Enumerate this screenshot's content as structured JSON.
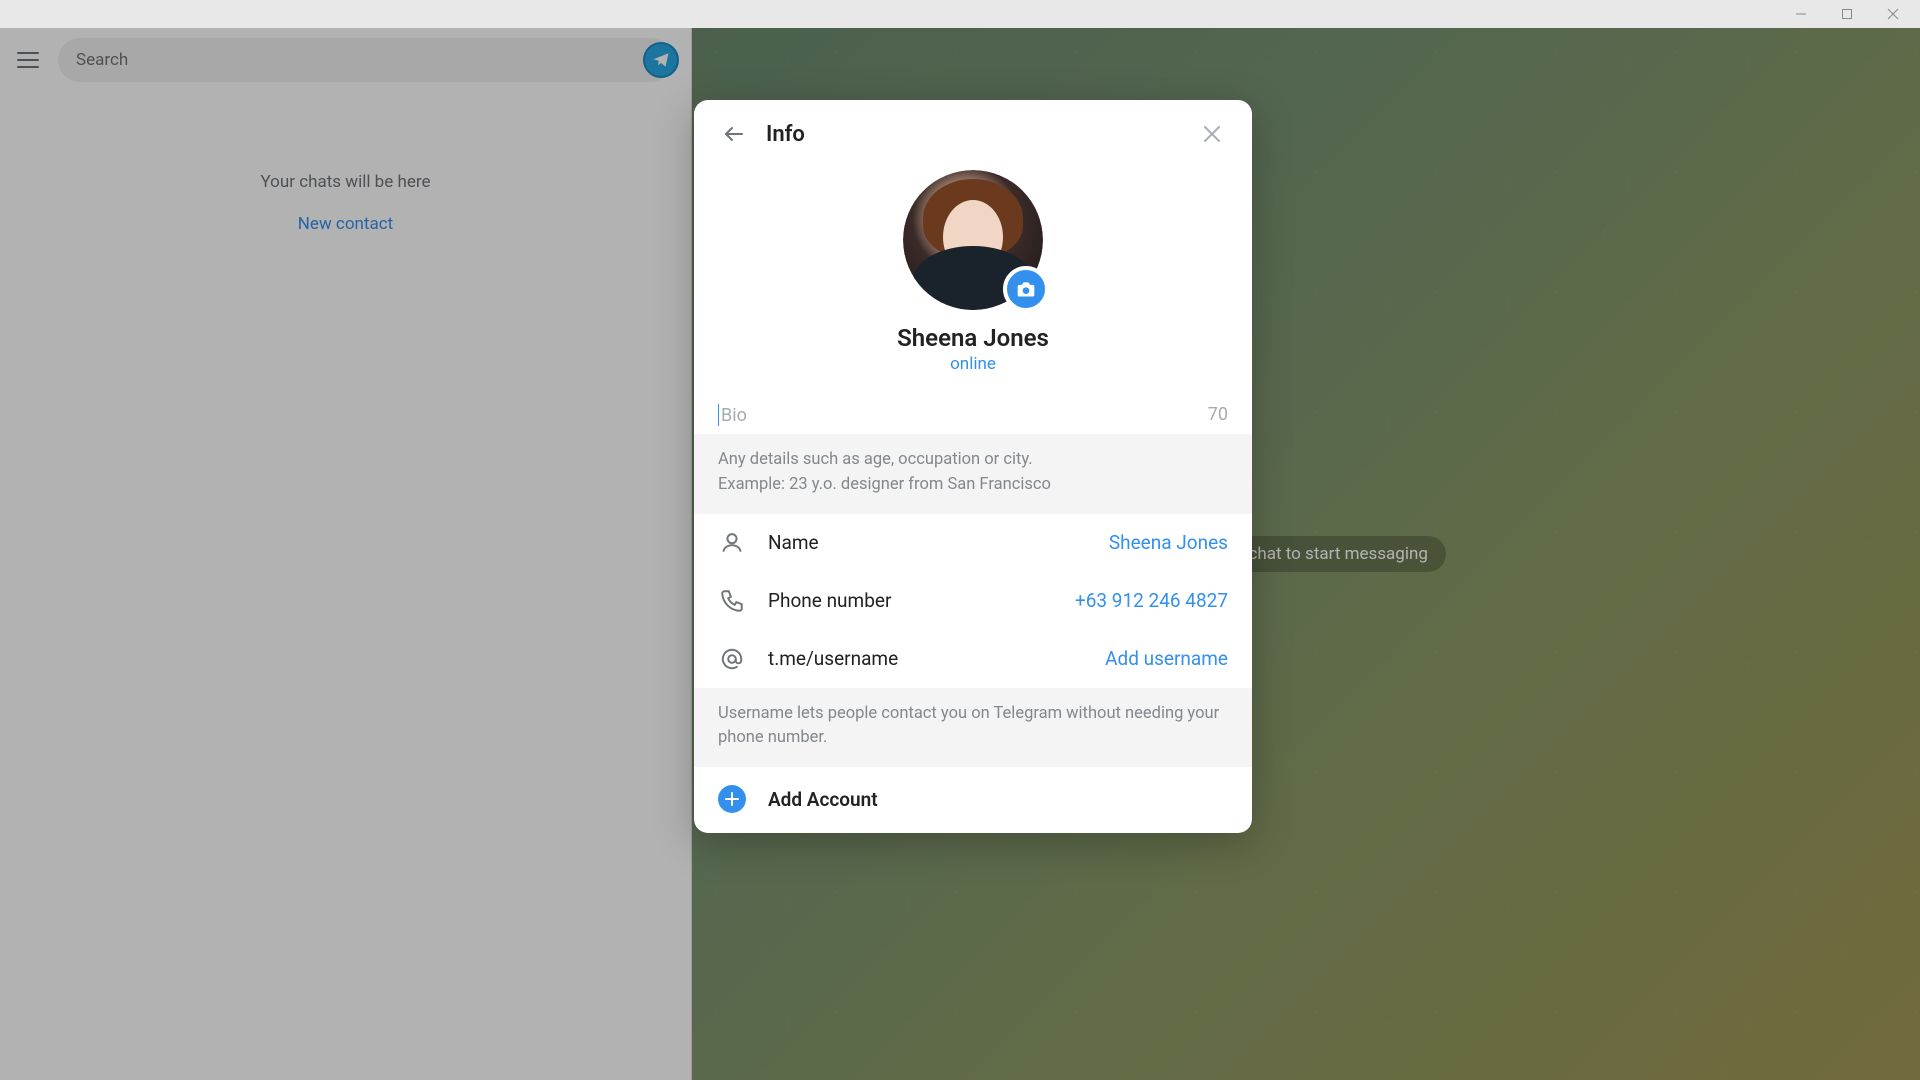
{
  "window": {
    "minimize": "−",
    "maximize": "□",
    "close": "✕"
  },
  "sidebar": {
    "search_placeholder": "Search",
    "empty_text": "Your chats will be here",
    "new_contact": "New contact"
  },
  "chat": {
    "hint": "Select a chat to start messaging"
  },
  "modal": {
    "title": "Info",
    "profile": {
      "name": "Sheena Jones",
      "status": "online"
    },
    "bio": {
      "placeholder": "Bio",
      "value": "",
      "remaining": "70"
    },
    "bio_hint_line1": "Any details such as age, occupation or city.",
    "bio_hint_line2": "Example: 23 y.o. designer from San Francisco",
    "rows": {
      "name": {
        "label": "Name",
        "value": "Sheena Jones"
      },
      "phone": {
        "label": "Phone number",
        "value": "+63 912 246 4827"
      },
      "username": {
        "label": "t.me/username",
        "value": "Add username"
      }
    },
    "username_hint": "Username lets people contact you on Telegram without needing your phone number.",
    "add_account": "Add Account"
  }
}
